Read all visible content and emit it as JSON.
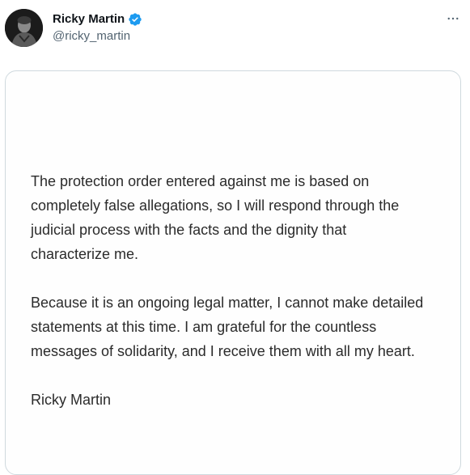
{
  "author": {
    "display_name": "Ricky Martin",
    "handle": "@ricky_martin",
    "verified": true,
    "verified_color": "#1d9bf0"
  },
  "menu": {
    "more_icon": "more-horizontal-icon"
  },
  "statement": {
    "paragraph_1": [
      "The protection order entered against me is based on",
      "completely false allegations, so I will respond through the",
      "judicial process with the facts and the dignity that",
      "characterize me."
    ],
    "paragraph_2": [
      "Because it is an ongoing legal matter, I cannot make detailed",
      "statements at this time. I am grateful for the countless",
      "messages of solidarity, and I receive them with all my heart."
    ],
    "signature": "Ricky Martin"
  }
}
